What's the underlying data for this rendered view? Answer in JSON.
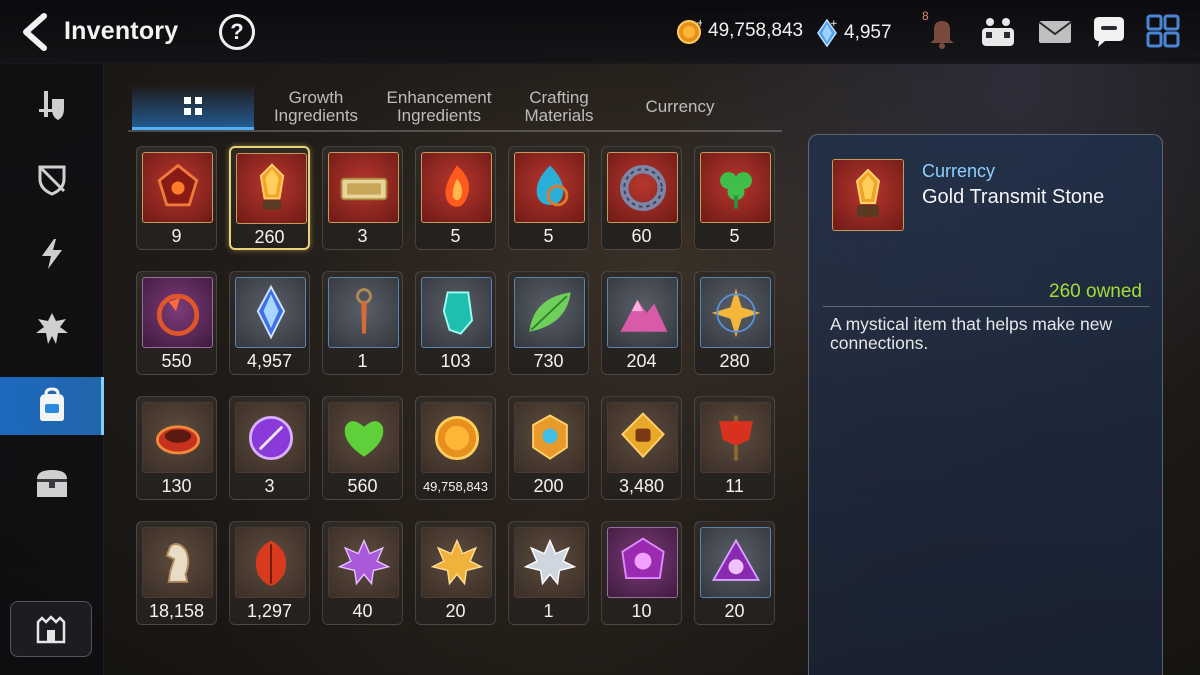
{
  "header": {
    "title": "Inventory",
    "help_label": "?",
    "gold": "49,758,843",
    "crystals": "4,957",
    "notification_count": "8"
  },
  "sidenav": {
    "items": [
      {
        "name": "equipment",
        "icon": "sword-shield-icon"
      },
      {
        "name": "unequipped",
        "icon": "broken-shield-icon"
      },
      {
        "name": "skills",
        "icon": "lightning-icon"
      },
      {
        "name": "artifacts",
        "icon": "crest-icon"
      },
      {
        "name": "materials",
        "icon": "bag-icon",
        "active": true
      },
      {
        "name": "chests",
        "icon": "chest-icon"
      }
    ],
    "home_icon": "castle-icon"
  },
  "tabs": [
    {
      "label": "",
      "icon": "grid-icon",
      "active": true
    },
    {
      "label": "Growth Ingredients"
    },
    {
      "label": "Enhancement Ingredients"
    },
    {
      "label": "Crafting Materials"
    },
    {
      "label": "Currency"
    }
  ],
  "items": [
    {
      "qty": "9",
      "frame": "red",
      "icon": "red-rune"
    },
    {
      "qty": "260",
      "frame": "red",
      "icon": "gold-transmit-stone",
      "selected": true
    },
    {
      "qty": "3",
      "frame": "red",
      "icon": "ticket"
    },
    {
      "qty": "5",
      "frame": "red",
      "icon": "fire-charm"
    },
    {
      "qty": "5",
      "frame": "red",
      "icon": "water-charm"
    },
    {
      "qty": "60",
      "frame": "red",
      "icon": "stone-ring"
    },
    {
      "qty": "5",
      "frame": "red",
      "icon": "clover-charm"
    },
    {
      "qty": "550",
      "frame": "purple",
      "icon": "moon-amulet"
    },
    {
      "qty": "4,957",
      "frame": "blue",
      "icon": "crystal"
    },
    {
      "qty": "1",
      "frame": "blue",
      "icon": "key-dagger"
    },
    {
      "qty": "103",
      "frame": "blue",
      "icon": "teal-crystal"
    },
    {
      "qty": "730",
      "frame": "blue",
      "icon": "leaf"
    },
    {
      "qty": "204",
      "frame": "blue",
      "icon": "pink-mountain"
    },
    {
      "qty": "280",
      "frame": "blue",
      "icon": "star-charm"
    },
    {
      "qty": "130",
      "frame": "brown",
      "icon": "red-bracelet"
    },
    {
      "qty": "3",
      "frame": "brown",
      "icon": "purple-badge"
    },
    {
      "qty": "560",
      "frame": "brown",
      "icon": "green-heart"
    },
    {
      "qty": "49,758,843",
      "frame": "brown",
      "icon": "gold-coin",
      "small": true
    },
    {
      "qty": "200",
      "frame": "brown",
      "icon": "gold-emblem"
    },
    {
      "qty": "3,480",
      "frame": "brown",
      "icon": "fist-emblem"
    },
    {
      "qty": "11",
      "frame": "brown",
      "icon": "red-banner"
    },
    {
      "qty": "18,158",
      "frame": "brown",
      "icon": "horse-figure"
    },
    {
      "qty": "1,297",
      "frame": "brown",
      "icon": "red-leaf"
    },
    {
      "qty": "40",
      "frame": "brown",
      "icon": "purple-lotus"
    },
    {
      "qty": "20",
      "frame": "brown",
      "icon": "gold-lotus"
    },
    {
      "qty": "1",
      "frame": "brown",
      "icon": "silver-lotus"
    },
    {
      "qty": "10",
      "frame": "purple",
      "icon": "moon-gem"
    },
    {
      "qty": "20",
      "frame": "blue",
      "icon": "moon-triangle"
    }
  ],
  "detail": {
    "category": "Currency",
    "name": "Gold Transmit Stone",
    "owned": "260 owned",
    "description": "A mystical item that helps make new connections."
  },
  "colors": {
    "accent": "#2b8ae0",
    "owned": "#a2dd3a",
    "category": "#8fd0ff",
    "selected_border": "#e9d37a"
  }
}
